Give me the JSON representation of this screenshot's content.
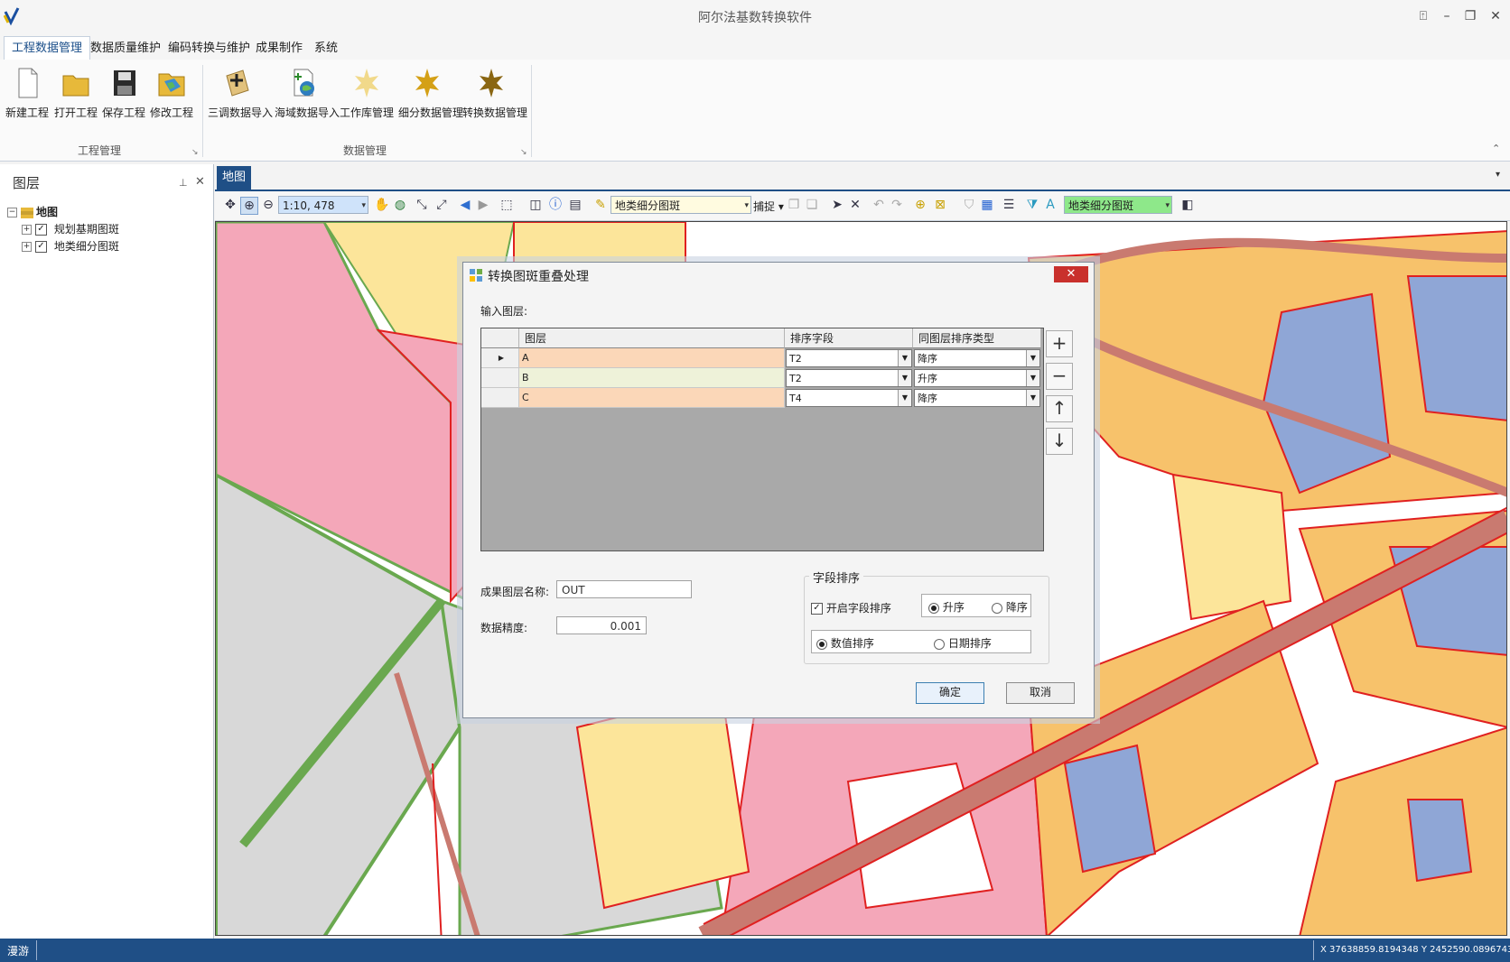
{
  "window": {
    "title": "阿尔法基数转换软件"
  },
  "menu_tabs": [
    "工程数据管理",
    "数据质量维护",
    "编码转换与维护",
    "成果制作",
    "系统"
  ],
  "ribbon": {
    "project_group": {
      "label": "工程管理",
      "buttons": [
        "新建工程",
        "打开工程",
        "保存工程",
        "修改工程"
      ]
    },
    "data_group": {
      "label": "数据管理",
      "buttons": [
        "三调数据导入",
        "海域数据导入",
        "工作库管理",
        "细分数据管理",
        "转换数据管理"
      ]
    }
  },
  "layer_panel": {
    "title": "图层",
    "root": "地图",
    "layers": [
      {
        "name": "规划基期图斑",
        "checked": true
      },
      {
        "name": "地类细分图斑",
        "checked": true
      }
    ]
  },
  "map": {
    "tab": "地图",
    "scale": "1:10, 478",
    "layer_combo": "地类细分图斑",
    "snap_label": "捕捉",
    "target_layer_combo": "地类细分图斑"
  },
  "dialog": {
    "title": "转换图斑重叠处理",
    "input_label": "输入图层:",
    "columns": [
      "图层",
      "排序字段",
      "同图层排序类型"
    ],
    "rows": [
      {
        "layer": "A",
        "field": "T2",
        "order": "降序"
      },
      {
        "layer": "B",
        "field": "T2",
        "order": "升序"
      },
      {
        "layer": "C",
        "field": "T4",
        "order": "降序"
      }
    ],
    "side_buttons": [
      "+",
      "−",
      "↑",
      "↓"
    ],
    "result_label": "成果图层名称:",
    "result_value": "OUT",
    "precision_label": "数据精度:",
    "precision_value": "0.001",
    "sort_group": {
      "title": "字段排序",
      "enable_label": "开启字段排序",
      "asc_label": "升序",
      "desc_label": "降序",
      "numeric_label": "数值排序",
      "date_label": "日期排序"
    },
    "ok_label": "确定",
    "cancel_label": "取消"
  },
  "status": {
    "mode": "漫游",
    "coords": "X 37638859.8194348 Y 2452590.08967435"
  }
}
